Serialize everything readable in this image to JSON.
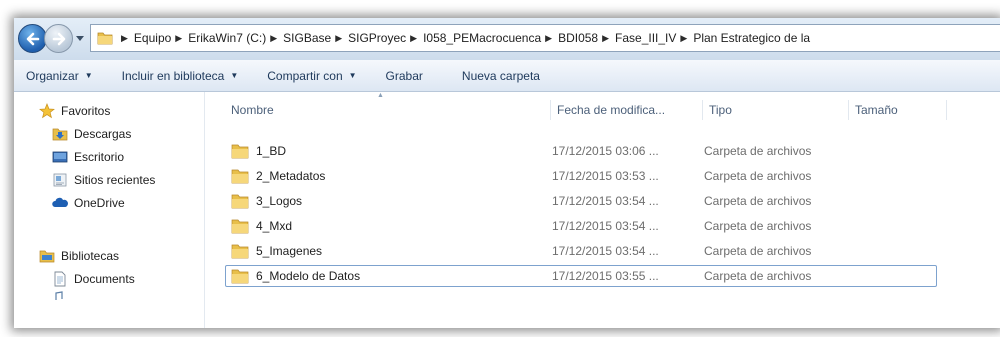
{
  "breadcrumb": [
    "Equipo",
    "ErikaWin7 (C:)",
    "SIGBase",
    "SIGProyec",
    "I058_PEMacrocuenca",
    "BDI058",
    "Fase_III_IV",
    "Plan Estrategico de la"
  ],
  "toolbar": {
    "organize": "Organizar",
    "include_library": "Incluir en biblioteca",
    "share_with": "Compartir con",
    "burn": "Grabar",
    "new_folder": "Nueva carpeta"
  },
  "navpane": {
    "favorites": "Favoritos",
    "downloads": "Descargas",
    "desktop": "Escritorio",
    "recent": "Sitios recientes",
    "onedrive": "OneDrive",
    "libraries": "Bibliotecas",
    "documents": "Documents"
  },
  "columns": {
    "name": "Nombre",
    "date": "Fecha de modifica...",
    "type": "Tipo",
    "size": "Tamaño"
  },
  "files": [
    {
      "name": "1_BD",
      "date": "17/12/2015 03:06 ...",
      "type": "Carpeta de archivos"
    },
    {
      "name": "2_Metadatos",
      "date": "17/12/2015 03:53 ...",
      "type": "Carpeta de archivos"
    },
    {
      "name": "3_Logos",
      "date": "17/12/2015 03:54 ...",
      "type": "Carpeta de archivos"
    },
    {
      "name": "4_Mxd",
      "date": "17/12/2015 03:54 ...",
      "type": "Carpeta de archivos"
    },
    {
      "name": "5_Imagenes",
      "date": "17/12/2015 03:54 ...",
      "type": "Carpeta de archivos"
    },
    {
      "name": "6_Modelo de Datos",
      "date": "17/12/2015 03:55 ...",
      "type": "Carpeta de archivos"
    }
  ],
  "icons": {
    "back": "back-arrow-icon",
    "forward": "forward-arrow-icon",
    "folder": "folder-icon",
    "star": "star-icon",
    "libraries": "libraries-icon"
  },
  "colors": {
    "accent": "#1f5fae",
    "command_text": "#1e395b",
    "focus_border": "#7da2ce",
    "folder_yellow": "#e8bf4a"
  }
}
